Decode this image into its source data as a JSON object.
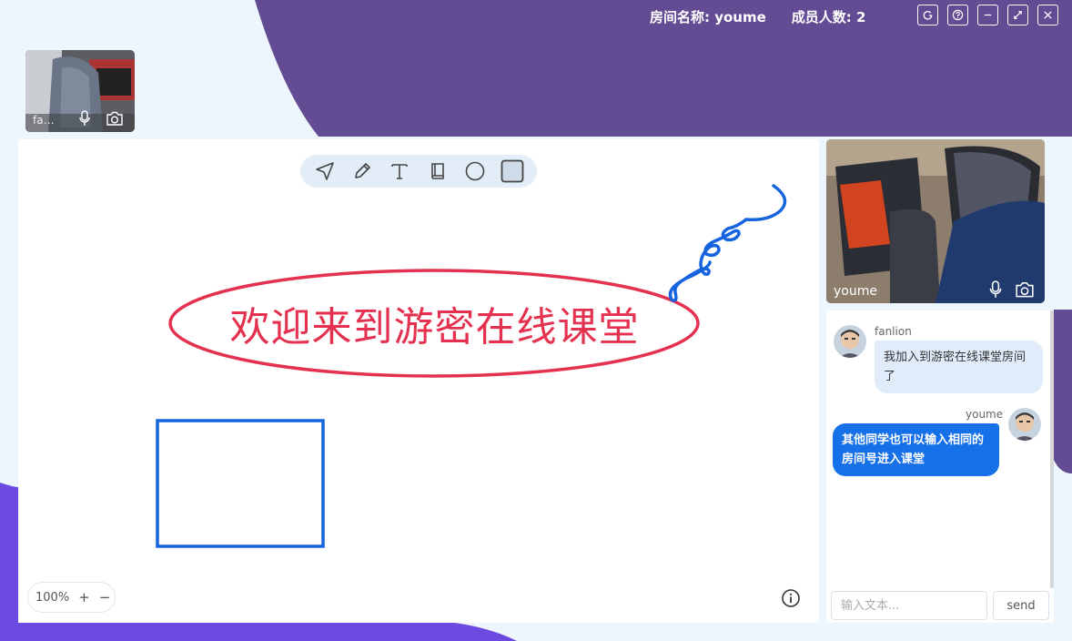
{
  "header": {
    "room_name": "房间名称: youme",
    "member_count": "成员人数: 2",
    "buttons": [
      {
        "name": "refresh-icon"
      },
      {
        "name": "help-icon"
      },
      {
        "name": "minimize-icon"
      },
      {
        "name": "expand-icon"
      },
      {
        "name": "close-icon"
      }
    ]
  },
  "small_video": {
    "name": "fanli..."
  },
  "whiteboard": {
    "tools": [
      "select-arrow-icon",
      "pencil-icon",
      "text-icon",
      "book-icon",
      "circle-icon",
      "rectangle-icon"
    ],
    "text": "欢迎来到游密在线课堂",
    "text_color": "#e4314f",
    "shape_color": "#1663e0",
    "zoom": "100%",
    "zoom_in": "+",
    "zoom_out": "−"
  },
  "main_video": {
    "name": "youme"
  },
  "chat": {
    "messages": [
      {
        "sender": "fanlion",
        "text": "我加入到游密在线课堂房间了",
        "self": false
      },
      {
        "sender": "youme",
        "text": "其他同学也可以输入相同的房间号进入课堂",
        "self": true
      }
    ],
    "input_placeholder": "输入文本...",
    "send_label": "send"
  },
  "colors": {
    "purple": "#634c94",
    "violet": "#6d4be0",
    "accent": "#1670e8"
  }
}
